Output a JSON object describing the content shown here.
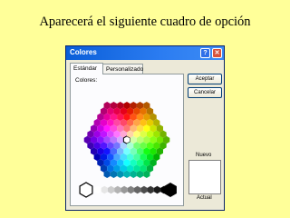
{
  "caption": "Aparecerá el siguiente cuadro de opción",
  "dialog": {
    "title": "Colores",
    "help_symbol": "?",
    "close_symbol": "✕",
    "tabs": [
      {
        "label": "Estándar",
        "active": true
      },
      {
        "label": "Personalizado",
        "active": false
      }
    ],
    "colors_label": "Colores:",
    "buttons": {
      "accept": "Aceptar",
      "cancel": "Cancelar"
    },
    "new_label": "Nuevo",
    "current_label": "Actual",
    "new_color": "#ffffff",
    "current_color": "#ffffff",
    "selected_color": "#ffffff"
  },
  "colors": {
    "background": "#ffff99",
    "titlebar": "#2b7cf1",
    "dialog_face": "#ece9d8"
  }
}
